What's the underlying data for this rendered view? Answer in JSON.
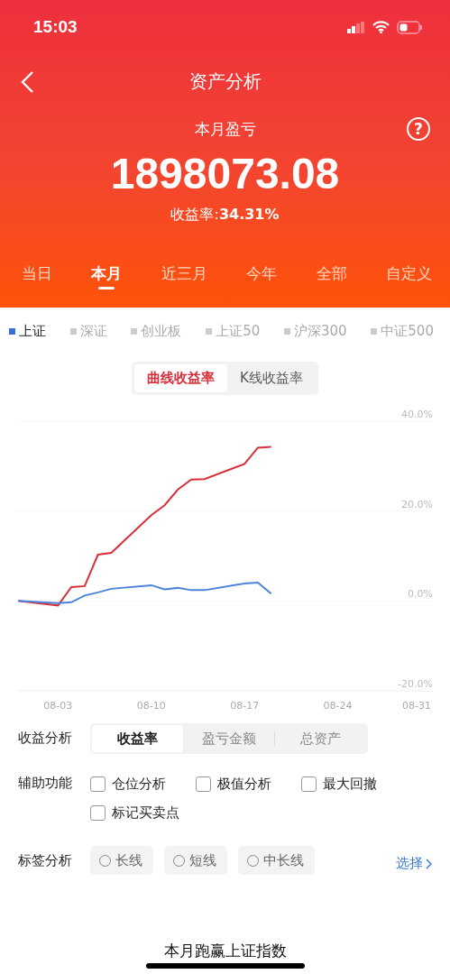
{
  "status_bar": {
    "time": "15:03"
  },
  "nav": {
    "title": "资产分析"
  },
  "summary": {
    "label": "本月盈亏",
    "help": "?",
    "amount": "1898073.08",
    "rate_label": "收益率:",
    "rate": "34.31%"
  },
  "periods": [
    {
      "label": "当日",
      "selected": false
    },
    {
      "label": "本月",
      "selected": true
    },
    {
      "label": "近三月",
      "selected": false
    },
    {
      "label": "今年",
      "selected": false
    },
    {
      "label": "全部",
      "selected": false
    },
    {
      "label": "自定义",
      "selected": false
    }
  ],
  "indices": [
    {
      "label": "上证",
      "selected": true
    },
    {
      "label": "深证",
      "selected": false
    },
    {
      "label": "创业板",
      "selected": false
    },
    {
      "label": "上证50",
      "selected": false
    },
    {
      "label": "沪深300",
      "selected": false
    },
    {
      "label": "中证500",
      "selected": false
    }
  ],
  "chart_modes": [
    {
      "label": "曲线收益率",
      "selected": true
    },
    {
      "label": "K线收益率",
      "selected": false
    }
  ],
  "chart_data": {
    "type": "line",
    "categories": [
      null,
      null,
      null,
      "08-03",
      null,
      null,
      null,
      null,
      null,
      null,
      "08-10",
      null,
      null,
      null,
      null,
      null,
      null,
      "08-17",
      null,
      null,
      null,
      null,
      null,
      null,
      "08-24",
      null,
      null,
      null,
      null,
      null,
      null,
      "08-31"
    ],
    "series": [
      {
        "color": "#d7303a",
        "values": [
          0,
          null,
          null,
          -1.0,
          3.1,
          3.3,
          10.3,
          10.7,
          null,
          null,
          19.1,
          21.3,
          24.8,
          27.0,
          27.1,
          null,
          null,
          30.5,
          34.1,
          34.3,
          null,
          null,
          null,
          null,
          null,
          null,
          null,
          null,
          null,
          null,
          null,
          null
        ]
      },
      {
        "color": "#4a84d8",
        "values": [
          0,
          null,
          null,
          -0.5,
          -0.3,
          1.2,
          1.9,
          2.7,
          null,
          null,
          3.5,
          2.6,
          2.9,
          2.4,
          2.4,
          null,
          null,
          3.9,
          4.1,
          1.6,
          null,
          null,
          null,
          null,
          null,
          null,
          null,
          null,
          null,
          null,
          null,
          null
        ]
      }
    ],
    "ylim": [
      -20,
      40
    ],
    "yticks": [
      {
        "value": 40,
        "label": "40.0%"
      },
      {
        "value": 20,
        "label": "20.0%"
      },
      {
        "value": 0,
        "label": "0.0%"
      },
      {
        "value": -20,
        "label": "-20.0%"
      }
    ]
  },
  "analysis": {
    "label": "收益分析",
    "options": [
      {
        "label": "收益率",
        "selected": true
      },
      {
        "label": "盈亏金额",
        "selected": false
      },
      {
        "label": "总资产",
        "selected": false
      }
    ]
  },
  "aux": {
    "label": "辅助功能",
    "options": [
      {
        "label": "仓位分析",
        "checked": false
      },
      {
        "label": "极值分析",
        "checked": false
      },
      {
        "label": "最大回撤",
        "checked": false
      },
      {
        "label": "标记买卖点",
        "checked": false
      }
    ]
  },
  "tags": {
    "label": "标签分析",
    "options": [
      {
        "label": "长线",
        "selected": false
      },
      {
        "label": "短线",
        "selected": false
      },
      {
        "label": "中长线",
        "selected": false
      }
    ],
    "select": "选择"
  },
  "footer": {
    "text": "本月跑赢上证指数"
  }
}
